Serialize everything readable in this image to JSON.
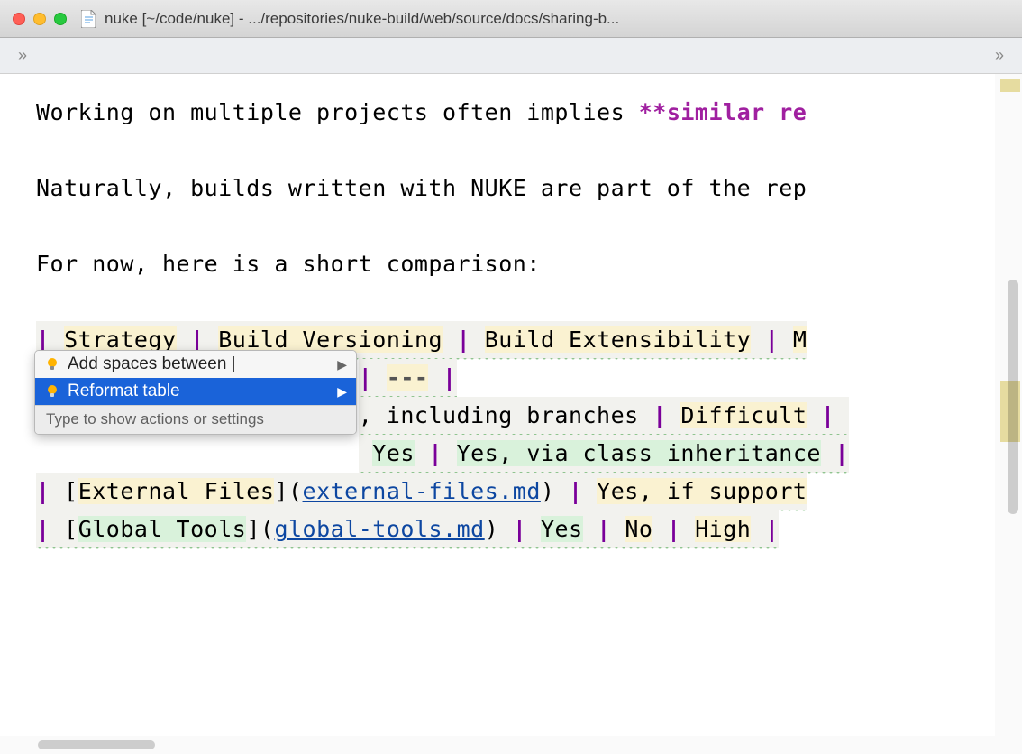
{
  "window": {
    "title": "nuke [~/code/nuke] - .../repositories/nuke-build/web/source/docs/sharing-b..."
  },
  "breadcrumb": {
    "left_chevron": "»",
    "right_chevron": "»"
  },
  "editor": {
    "line1_a": "Working on multiple projects often implies ",
    "line1_b": "**similar re",
    "line2": "Naturally, builds written with NUKE are part of the rep",
    "line3": "For now, here is a short comparison:",
    "header_cells": [
      "Strategy",
      "Build Versioning",
      "Build Extensibility",
      "M"
    ],
    "sep_tail": "---",
    "row1_rest": ", including branches",
    "row1_c2": "Difficult",
    "row2_a": "Yes",
    "row2_b": "Yes, via class inheritance",
    "row3_link_text": "External Files",
    "row3_link_url": "external-files.md",
    "row3_c2": "Yes, if support",
    "row4_link_text": "Global Tools",
    "row4_link_url": "global-tools.md",
    "row4_c1": "Yes",
    "row4_c2": "No",
    "row4_c3": "High"
  },
  "popup": {
    "item1": "Add spaces between |",
    "item2": "Reformat table",
    "hint": "Type to show actions or settings"
  }
}
